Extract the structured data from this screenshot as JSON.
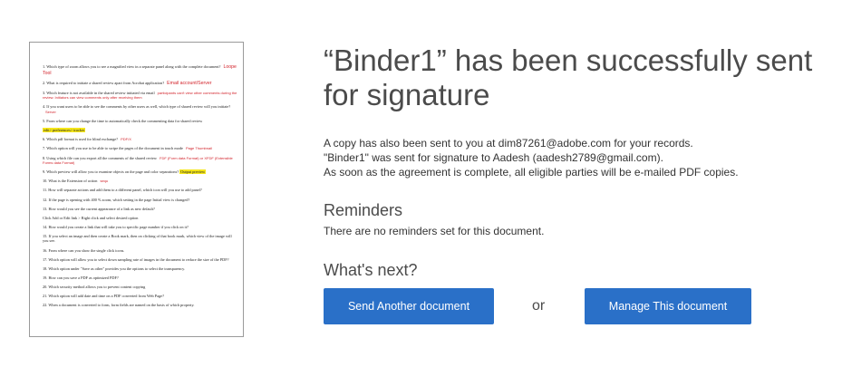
{
  "document_preview": {
    "lines": [
      {
        "text": "1. Which type of zoom allows you to see a magnified view in a separate panel along with the complete document?",
        "answer": "Loope Tool",
        "answer_style": "big"
      },
      {
        "text": "2. What is required to initiate a shared review apart from Acrobat application?",
        "answer": "Email account/Server",
        "answer_style": "big"
      },
      {
        "text": "3. Which feature is not available in the shared review initiated via email",
        "answer": "participants can't view other comments during the review. Initiators can view comments only after receiving them",
        "answer_style": "small"
      },
      {
        "text": "4. If you want users to be able to see the comments by other users as well, which type of shared review will you initiate?",
        "answer": "Server",
        "answer_style": "small"
      },
      {
        "text": "5. From where can you change the time to automatically check the commenting data for shared review",
        "answer": "",
        "answer_style": "small"
      },
      {
        "text": "",
        "highlight": "edit> preferences> tracker",
        "answer": "",
        "answer_style": "small"
      },
      {
        "text": "6. Which pdf format is used for blind exchange?",
        "answer": "PDF/X",
        "answer_style": "small"
      },
      {
        "text": "7. Which option will you use to be able to swipe the pages of the document in touch mode",
        "answer": "Page Thumbnail",
        "answer_style": "small"
      },
      {
        "text": "8. Using which file can you export all the comments of the shared review",
        "answer": "FDF (Form data Format) or XFDF (Extensible Forms data Format)",
        "answer_style": "small"
      },
      {
        "text": "9. Which preview will allow you to examine objects on the page and color separations?",
        "highlight": "Output preview",
        "answer": "",
        "answer_style": "small"
      },
      {
        "text": "10. What is the Extension of action",
        "answer": "sequ",
        "answer_style": "small"
      },
      {
        "text": "11. How will separate actions and add them to a different panel, which icon will you use to add panel?",
        "answer": "",
        "answer_style": "small"
      },
      {
        "text": "12. If the page is opening with 400 % zoom, which setting in the page Initial view is changed?",
        "answer": "",
        "answer_style": "small"
      },
      {
        "text": "13. How would you see the current appearance of a link as new default?",
        "answer": "",
        "answer_style": "small"
      },
      {
        "text": "Click Add or Edit link > Right click and select desired option",
        "answer": "",
        "answer_style": "small"
      },
      {
        "text": "14. How would you create a link that will take you to specific page number if you click on it?",
        "answer": "",
        "answer_style": "small"
      },
      {
        "text": "15. If you select an image and then create a Book mark, then on clicking of that book mark, which view of the image will you see.",
        "answer": "",
        "answer_style": "small"
      },
      {
        "text": "16. From where can you show the single click icons.",
        "answer": "",
        "answer_style": "small"
      },
      {
        "text": "17. Which option will allow you to select down sampling rate of images in the document to reduce the size of the PDF?",
        "answer": "",
        "answer_style": "small"
      },
      {
        "text": "18. Which option under \"Save as other\" provides you the options to select the transparency.",
        "answer": "",
        "answer_style": "small"
      },
      {
        "text": "19. How can you save a PDF as optimized PDF?",
        "answer": "",
        "answer_style": "small"
      },
      {
        "text": "20. Which security method allows you to prevent content copying",
        "answer": "",
        "answer_style": "small"
      },
      {
        "text": "21. Which option will add date and time on a PDF converted from Web Page?",
        "answer": "",
        "answer_style": "small"
      },
      {
        "text": "22. When a document is converted to form, form fields are named on the basis of which property.",
        "answer": "",
        "answer_style": "small"
      }
    ]
  },
  "confirmation": {
    "title": "“Binder1” has been successfully sent for signature",
    "copy_line": "A copy has also been sent to you at dim87261@adobe.com for your records.",
    "sent_line": "\"Binder1\" was sent for signature to Aadesh (aadesh2789@gmail.com).",
    "complete_line": "As soon as the agreement is complete, all eligible parties will be e-mailed PDF copies."
  },
  "reminders": {
    "heading": "Reminders",
    "text": "There are no reminders set for this document."
  },
  "next": {
    "heading": "What's next?",
    "send_label": "Send Another document",
    "or_label": "or",
    "manage_label": "Manage This document"
  },
  "colors": {
    "button_blue": "#2a70c8",
    "answer_red": "#d2222a",
    "highlight_yellow": "#f5e61a"
  }
}
